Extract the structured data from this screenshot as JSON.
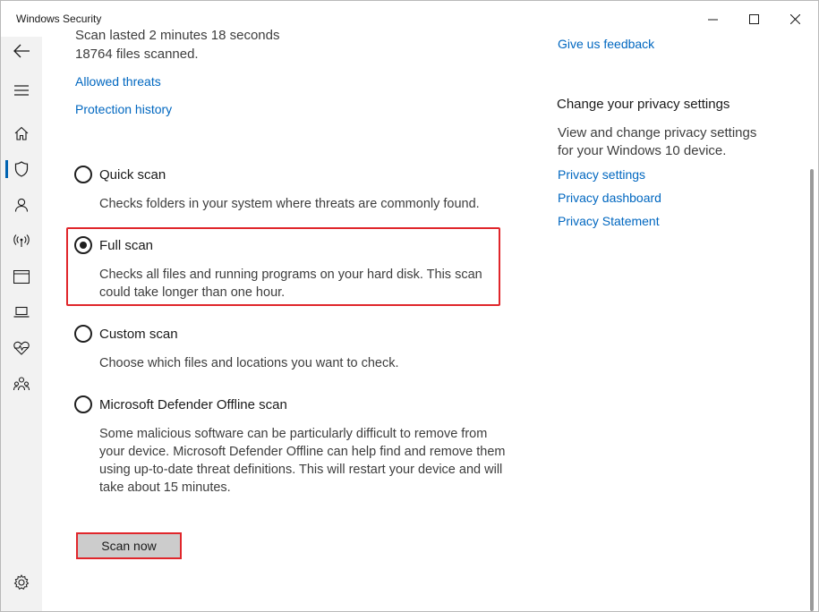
{
  "window": {
    "title": "Windows Security"
  },
  "sidebar": {
    "items": [
      {
        "icon": "back-arrow-icon"
      },
      {
        "icon": "hamburger-menu-icon"
      },
      {
        "icon": "home-icon"
      },
      {
        "icon": "shield-icon",
        "active": true
      },
      {
        "icon": "person-icon"
      },
      {
        "icon": "wireless-icon"
      },
      {
        "icon": "app-browser-icon"
      },
      {
        "icon": "laptop-icon"
      },
      {
        "icon": "heart-pulse-icon"
      },
      {
        "icon": "family-icon"
      }
    ],
    "settings_icon": "gear-icon"
  },
  "main": {
    "scan_info": {
      "duration_text": "Scan lasted 2 minutes 18 seconds",
      "files_text": "18764 files scanned."
    },
    "links": {
      "allowed_threats": "Allowed threats",
      "protection_history": "Protection history"
    },
    "options": [
      {
        "label": "Quick scan",
        "description": "Checks folders in your system where threats are commonly found.",
        "selected": false
      },
      {
        "label": "Full scan",
        "description": "Checks all files and running programs on your hard disk. This scan could take longer than one hour.",
        "selected": true
      },
      {
        "label": "Custom scan",
        "description": "Choose which files and locations you want to check.",
        "selected": false
      },
      {
        "label": "Microsoft Defender Offline scan",
        "description": "Some malicious software can be particularly difficult to remove from your device. Microsoft Defender Offline can help find and remove them using up-to-date threat definitions. This will restart your device and will take about 15 minutes.",
        "selected": false
      }
    ],
    "scan_button": "Scan now"
  },
  "right_panel": {
    "feedback_link": "Give us feedback",
    "privacy_heading": "Change your privacy settings",
    "privacy_text_line1": "View and change privacy settings",
    "privacy_text_line2": "for your Windows 10 device.",
    "privacy_links": [
      "Privacy settings",
      "Privacy dashboard",
      "Privacy Statement"
    ]
  },
  "colors": {
    "accent_link": "#0067c0",
    "highlight": "#e0262b",
    "sidebar_bg": "#f2f2f2",
    "button_bg": "#cccccc"
  }
}
